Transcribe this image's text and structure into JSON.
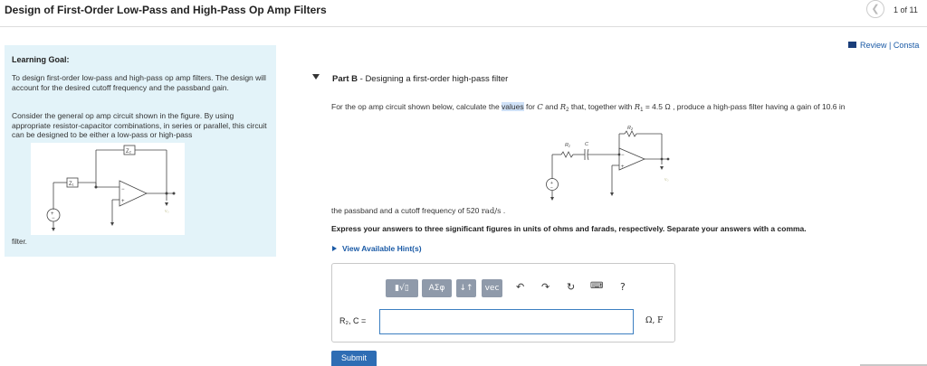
{
  "header": {
    "title": "Design of First-Order Low-Pass and High-Pass Op Amp Filters",
    "prev_icon": "chevron-left-icon",
    "page_counter": "1 of 11"
  },
  "sidebar": {
    "heading": "Learning Goal:",
    "paragraph1": "To design first-order low-pass and high-pass op amp filters. The design will account for the desired cutoff frequency and the passband gain.",
    "paragraph2": "Consider the general op amp circuit shown in the figure. By using appropriate resistor-capacitor combinations, in series or parallel, this circuit can be designed to be either a low-pass or high-pass",
    "trailing_word": "filter.",
    "figure": {
      "z1": "Z₁",
      "z2": "Z₂",
      "vo": "v₀"
    }
  },
  "review": {
    "icon": "book-icon",
    "label": "Review | Consta"
  },
  "part": {
    "caret_icon": "caret-down-icon",
    "label": "Part B",
    "separator": " - ",
    "title": "Designing a first-order high-pass filter"
  },
  "problem": {
    "seg1": "For the op amp circuit shown below, calculate the ",
    "seg_highlight": "values",
    "seg2": " for ",
    "var_c": "C",
    "seg3": " and ",
    "var_r2": "R",
    "var_r2_sub": "2",
    "seg4": " that, together with ",
    "var_r1": "R",
    "var_r1_sub": "1",
    "seg5": " = 4.5 Ω , produce a high-pass filter having a gain of 10.6 in",
    "figure": {
      "r1": "R₁",
      "c": "C",
      "r2": "R₂",
      "vo": "v₀"
    }
  },
  "passband": {
    "seg1": "the passband and a cutoff frequency of 520 ",
    "unit": "rad/s",
    "seg2": " ."
  },
  "instruction": "Express your answers to three significant figures in units of ohms and farads, respectively. Separate your answers with a comma.",
  "hint": {
    "icon": "caret-right-icon",
    "label": "View Available Hint(s)"
  },
  "toolbar": {
    "templates_icon": "templates-icon",
    "greek_label": "ΑΣφ",
    "sort_label": "↓↑",
    "vec_label": "vec",
    "undo_icon": "undo-icon",
    "redo_icon": "redo-icon",
    "reset_icon": "reset-icon",
    "keyboard_icon": "keyboard-icon",
    "help_label": "?"
  },
  "answer": {
    "label": "R₂, C =",
    "value": "",
    "units": "Ω, F"
  },
  "submit_label": "Submit"
}
